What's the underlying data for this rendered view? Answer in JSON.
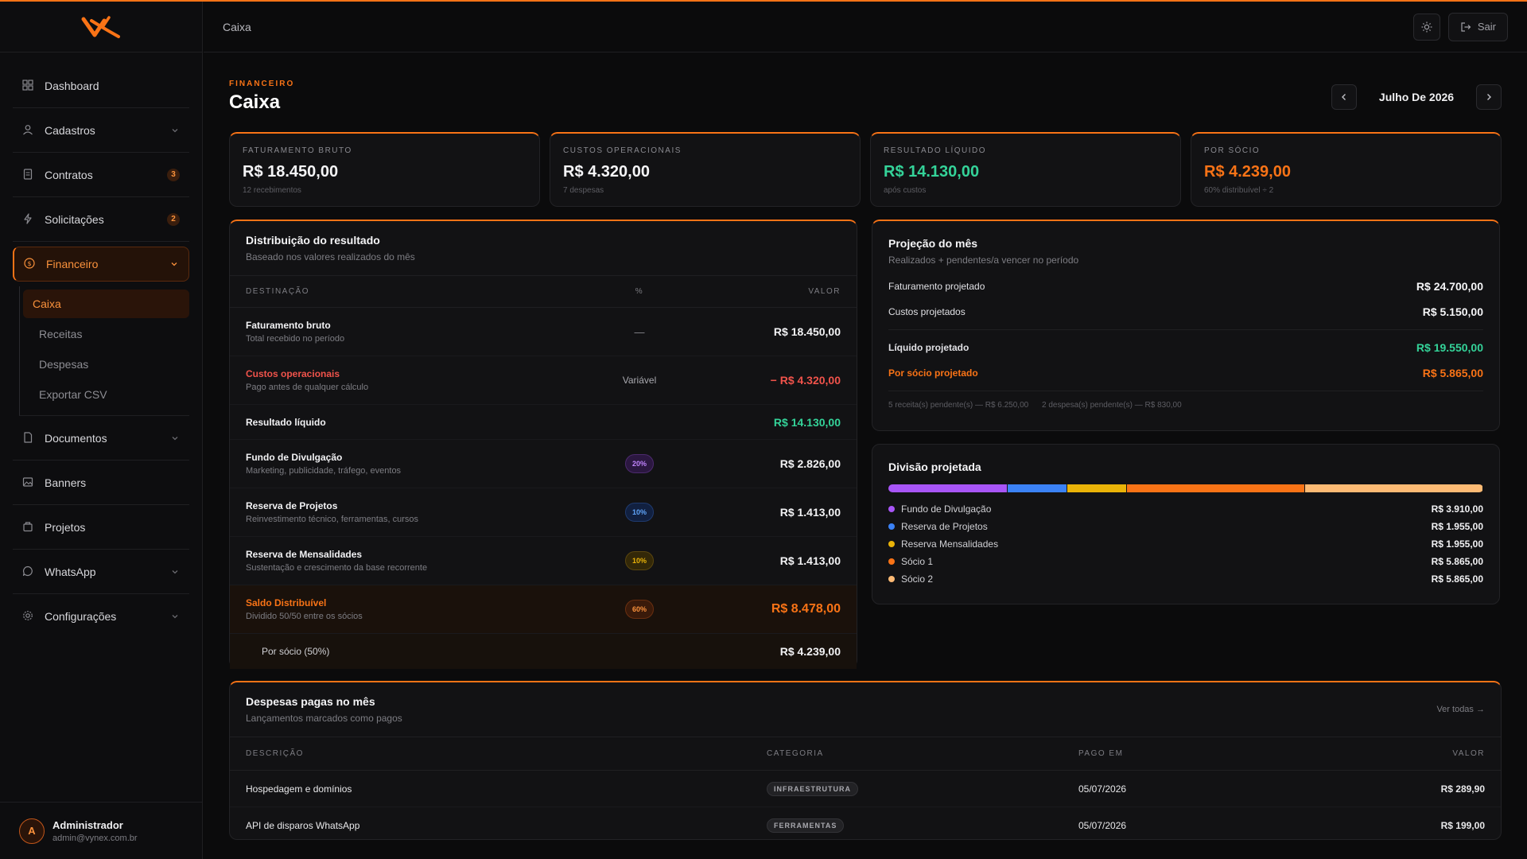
{
  "header": {
    "breadcrumb": "Caixa",
    "logout_label": "Sair"
  },
  "sidebar": {
    "items": [
      {
        "label": "Dashboard",
        "icon": "grid-icon"
      },
      {
        "label": "Cadastros",
        "icon": "users-icon",
        "chevron": true
      },
      {
        "label": "Contratos",
        "icon": "document-icon",
        "badge": "3"
      },
      {
        "label": "Solicitações",
        "icon": "bolt-icon",
        "badge": "2"
      },
      {
        "label": "Financeiro",
        "icon": "dollar-icon",
        "chevron": true,
        "active": true,
        "children": [
          "Caixa",
          "Receitas",
          "Despesas",
          "Exportar CSV"
        ]
      },
      {
        "label": "Documentos",
        "icon": "file-icon",
        "chevron": true
      },
      {
        "label": "Banners",
        "icon": "image-icon"
      },
      {
        "label": "Projetos",
        "icon": "folder-icon"
      },
      {
        "label": "WhatsApp",
        "icon": "chat-icon",
        "chevron": true
      },
      {
        "label": "Configurações",
        "icon": "gear-icon",
        "chevron": true
      }
    ],
    "user": {
      "initial": "A",
      "name": "Administrador",
      "email": "admin@vynex.com.br"
    }
  },
  "page": {
    "eyebrow": "FINANCEIRO",
    "title": "Caixa",
    "month": "Julho De 2026"
  },
  "kpis": [
    {
      "label": "FATURAMENTO BRUTO",
      "value": "R$ 18.450,00",
      "sub": "12 recebimentos"
    },
    {
      "label": "CUSTOS OPERACIONAIS",
      "value": "R$ 4.320,00",
      "sub": "7 despesas"
    },
    {
      "label": "RESULTADO LÍQUIDO",
      "value": "R$ 14.130,00",
      "sub": "após custos"
    },
    {
      "label": "POR SÓCIO",
      "value": "R$ 4.239,00",
      "sub": "60% distribuível ÷ 2"
    }
  ],
  "distribuicao": {
    "title": "Distribuição do resultado",
    "subtitle": "Baseado nos valores realizados do mês",
    "headers": [
      "DESTINAÇÃO",
      "%",
      "VALOR"
    ],
    "rows": [
      {
        "name": "Faturamento bruto",
        "desc": "Total recebido no período",
        "pct": "—",
        "value": "R$ 18.450,00"
      },
      {
        "name": "Custos operacionais",
        "desc": "Pago antes de qualquer cálculo",
        "pct": "Variável",
        "value": "− R$ 4.320,00"
      },
      {
        "name": "Resultado líquido",
        "value": "R$ 14.130,00"
      },
      {
        "name": "Fundo de Divulgação",
        "desc": "Marketing, publicidade, tráfego, eventos",
        "pct": "20%",
        "value": "R$ 2.826,00"
      },
      {
        "name": "Reserva de Projetos",
        "desc": "Reinvestimento técnico, ferramentas, cursos",
        "pct": "10%",
        "value": "R$ 1.413,00"
      },
      {
        "name": "Reserva de Mensalidades",
        "desc": "Sustentação e crescimento da base recorrente",
        "pct": "10%",
        "value": "R$ 1.413,00"
      },
      {
        "name": "Saldo Distribuível",
        "desc": "Dividido 50/50 entre os sócios",
        "pct": "60%",
        "value": "R$ 8.478,00"
      },
      {
        "name": "Por sócio (50%)",
        "value": "R$ 4.239,00"
      }
    ]
  },
  "projecao": {
    "title": "Projeção do mês",
    "subtitle": "Realizados + pendentes/a vencer no período",
    "lines": [
      {
        "label": "Faturamento projetado",
        "value": "R$ 24.700,00"
      },
      {
        "label": "Custos projetados",
        "value": "R$ 5.150,00"
      },
      {
        "label": "Líquido projetado",
        "value": "R$ 19.550,00"
      },
      {
        "label": "Por sócio projetado",
        "value": "R$ 5.865,00"
      }
    ],
    "footer": [
      "5 receita(s) pendente(s) — R$ 6.250,00",
      "2 despesa(s) pendente(s) — R$ 830,00"
    ]
  },
  "divisao": {
    "title": "Divisão projetada",
    "items": [
      {
        "name": "Fundo de Divulgação",
        "value": "R$ 3.910,00",
        "share": 0.2,
        "color": "#a855f7"
      },
      {
        "name": "Reserva de Projetos",
        "value": "R$ 1.955,00",
        "share": 0.1,
        "color": "#3b82f6"
      },
      {
        "name": "Reserva Mensalidades",
        "value": "R$ 1.955,00",
        "share": 0.1,
        "color": "#eab308"
      },
      {
        "name": "Sócio 1",
        "value": "R$ 5.865,00",
        "share": 0.3,
        "color": "#f97316"
      },
      {
        "name": "Sócio 2",
        "value": "R$ 5.865,00",
        "share": 0.3,
        "color": "#fdba74"
      }
    ]
  },
  "despesas": {
    "title": "Despesas pagas no mês",
    "subtitle": "Lançamentos marcados como pagos",
    "see_all": "Ver todas →",
    "headers": [
      "DESCRIÇÃO",
      "CATEGORIA",
      "PAGO EM",
      "VALOR"
    ],
    "rows": [
      {
        "desc": "Hospedagem e domínios",
        "category": "INFRAESTRUTURA",
        "date": "05/07/2026",
        "value": "R$ 289,90"
      },
      {
        "desc": "API de disparos WhatsApp",
        "category": "FERRAMENTAS",
        "date": "05/07/2026",
        "value": "R$ 199,00"
      }
    ]
  }
}
